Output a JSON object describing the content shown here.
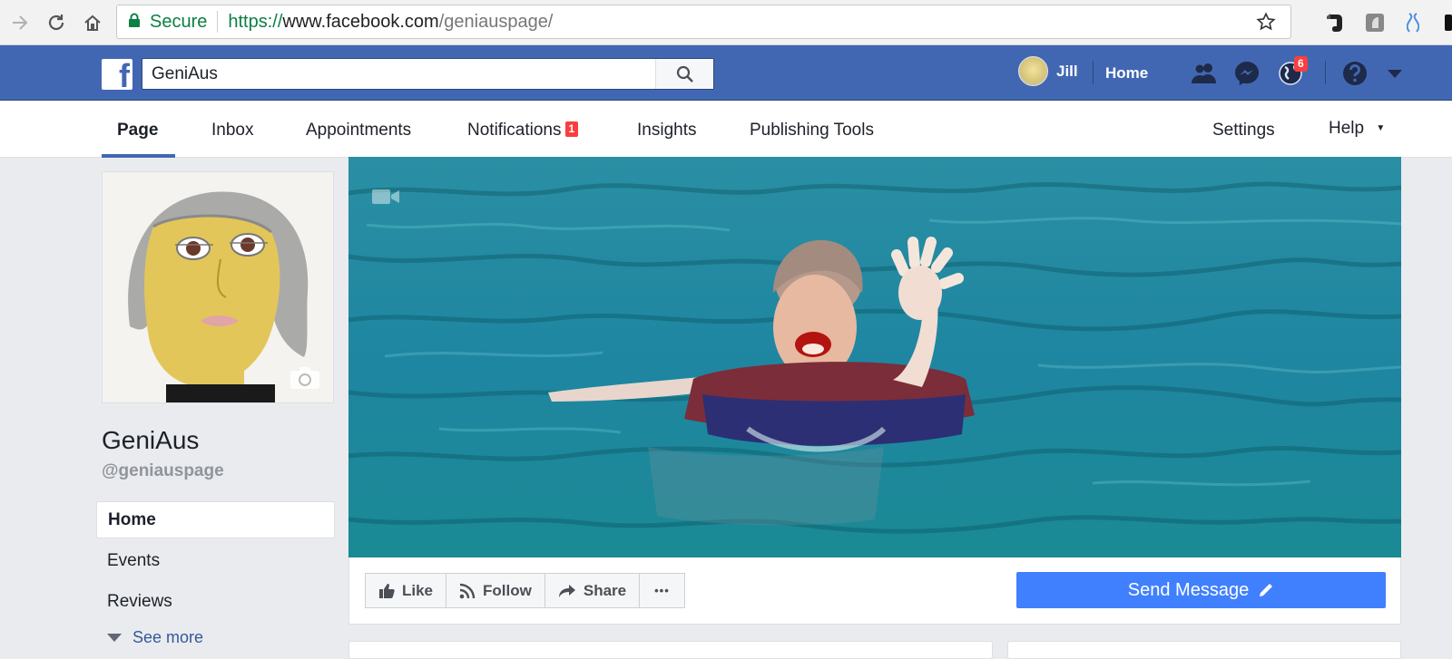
{
  "browser": {
    "secure_label": "Secure",
    "url_scheme": "https://",
    "url_host": "www.facebook.com",
    "url_path": "/geniauspage/"
  },
  "topbar": {
    "search_value": "GeniAus",
    "user_name": "Jill",
    "home_label": "Home",
    "notifications_count": "6",
    "colors": {
      "bar": "#4267b2",
      "badge": "#fa3e3e"
    }
  },
  "tabs": {
    "page": "Page",
    "inbox": "Inbox",
    "appointments": "Appointments",
    "notifications": "Notifications",
    "notifications_count": "1",
    "insights": "Insights",
    "publishing_tools": "Publishing Tools",
    "settings": "Settings",
    "help": "Help",
    "help_caret": "▼"
  },
  "page": {
    "name": "GeniAus",
    "handle": "@geniauspage"
  },
  "sidebar": {
    "items": [
      {
        "label": "Home"
      },
      {
        "label": "Events"
      },
      {
        "label": "Reviews"
      }
    ],
    "see_more": "See more"
  },
  "actions": {
    "like": "Like",
    "follow": "Follow",
    "share": "Share",
    "more": "•••",
    "send_message": "Send Message",
    "colors": {
      "send_message": "#4080ff"
    }
  }
}
